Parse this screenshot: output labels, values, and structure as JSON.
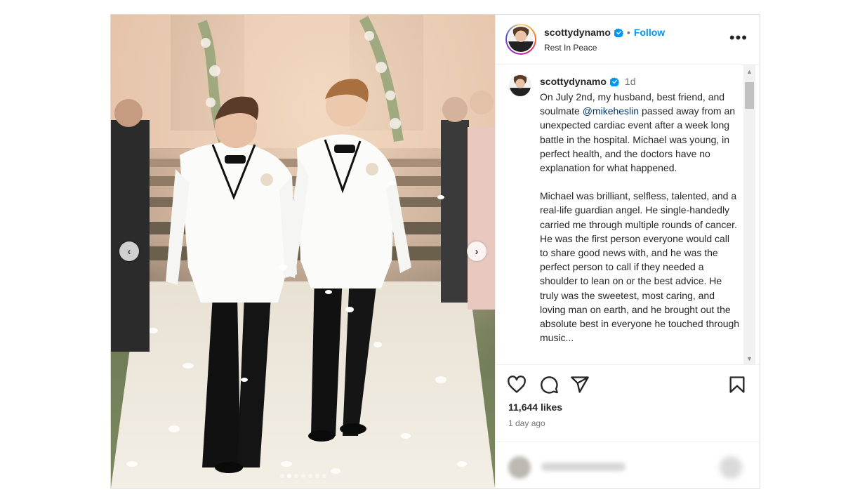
{
  "header": {
    "username": "scottydynamo",
    "separator": "•",
    "follow_label": "Follow",
    "subtitle": "Rest In Peace",
    "more_label": "•••"
  },
  "caption": {
    "username": "scottydynamo",
    "time": "1d",
    "lines_para1_before_mention": "On July 2nd, my husband, best friend, and soulmate ",
    "mention": "@mikeheslin",
    "lines_para1_after_mention": " passed away from an unexpected cardiac event after a week long battle in the hospital. Michael was young, in perfect health, and the doctors have no explanation for what happened.",
    "para2": "Michael was brilliant, selfless, talented, and a real-life guardian angel. He single-handedly carried me through multiple rounds of cancer. He was the first person everyone would call to share good news with, and he was the perfect person to call if they needed a shoulder to lean on or the best advice. He truly was the sweetest, most caring, and loving man on earth, and he brought out the absolute best in everyone he touched through music..."
  },
  "media": {
    "prev_label": "‹",
    "next_label": "›",
    "slide_count": 7,
    "active_slide": 2
  },
  "stats": {
    "likes": "11,644 likes",
    "posted_ago": "1 day ago"
  },
  "icons": {
    "verified": "verified-badge-icon",
    "like": "heart-icon",
    "comment": "comment-bubble-icon",
    "share": "paper-plane-icon",
    "save": "bookmark-icon"
  },
  "colors": {
    "accent": "#0095f6",
    "mention": "#00376b",
    "muted": "#737373",
    "text": "#262626"
  }
}
